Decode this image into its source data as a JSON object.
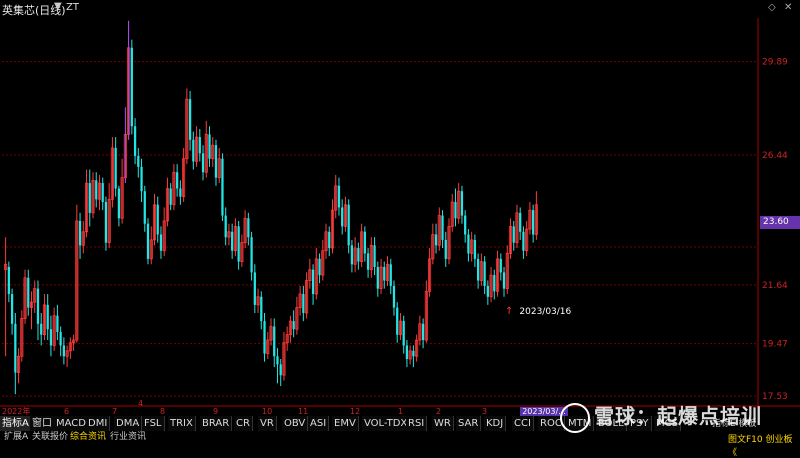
{
  "window": {
    "title": "英集芯(日线)",
    "dropdown_icon": "▼",
    "zt_label": "ZT"
  },
  "window_controls": [
    "◇",
    "✕"
  ],
  "axis": {
    "y_ticks": [
      "29.89",
      "26.44",
      "21.64",
      "19.47",
      "17.53"
    ],
    "current_price": "23.60"
  },
  "date_strip": {
    "months": [
      "2022年",
      "6",
      "7",
      "8",
      "9",
      "10",
      "11",
      "12",
      "1",
      "2",
      "3"
    ],
    "marker": "4",
    "cursor_date": "2023/03/..."
  },
  "annotation": {
    "arrow": "↑",
    "text": "2023/03/16"
  },
  "indicator_tabs": [
    "指标A",
    "窗口",
    "MACD",
    "DMI",
    "DMA",
    "FSL",
    "TRIX",
    "BRAR",
    "CR",
    "VR",
    "OBV",
    "ASI",
    "EMV",
    "VOL-TDX",
    "RSI",
    "WR",
    "SAR",
    "KDJ",
    "CCI",
    "ROC",
    "MTM",
    "BOLL",
    "PSY",
    "MCS"
  ],
  "sub_tabs": [
    "扩展A",
    "关联报价",
    "综合资讯",
    "行业资讯"
  ],
  "right_panel": {
    "mini_label": "指标E 模板",
    "f10_label": "图文F10 创业板《"
  },
  "watermark": {
    "text": "雪球：起爆点培训"
  },
  "colors": {
    "up": "#ff3b3b",
    "down": "#22e6e6",
    "bg": "#000000",
    "grid": "#7a0000",
    "price_tag": "#6633aa"
  },
  "chart_data": {
    "type": "candlestick",
    "ylim": [
      17.2,
      31.5
    ],
    "candles": [
      [
        22.2,
        22.4,
        23.4,
        19.0
      ],
      [
        22.3,
        21.3,
        22.5,
        21.0
      ],
      [
        21.3,
        20.2,
        21.5,
        19.8
      ],
      [
        20.2,
        18.4,
        20.6,
        17.6
      ],
      [
        18.4,
        19.0,
        19.3,
        18.0
      ],
      [
        19.0,
        20.4,
        20.7,
        18.8
      ],
      [
        20.4,
        21.9,
        22.2,
        20.2
      ],
      [
        21.9,
        20.8,
        22.2,
        20.5
      ],
      [
        20.8,
        21.0,
        21.4,
        20.0
      ],
      [
        21.0,
        21.5,
        21.8,
        20.6
      ],
      [
        21.5,
        20.2,
        21.8,
        19.6
      ],
      [
        20.2,
        19.8,
        20.6,
        19.4
      ],
      [
        19.8,
        20.9,
        21.3,
        19.6
      ],
      [
        20.9,
        20.0,
        21.3,
        19.6
      ],
      [
        20.0,
        19.4,
        20.5,
        19.0
      ],
      [
        19.4,
        20.5,
        20.8,
        19.2
      ],
      [
        20.5,
        19.9,
        20.9,
        19.6
      ],
      [
        19.9,
        19.4,
        20.1,
        19.0
      ],
      [
        19.4,
        19.0,
        19.7,
        18.7
      ],
      [
        19.0,
        19.2,
        19.4,
        18.6
      ],
      [
        19.2,
        19.5,
        19.7,
        18.9
      ],
      [
        19.5,
        19.6,
        19.8,
        19.2
      ],
      [
        19.6,
        24.0,
        24.6,
        19.5
      ],
      [
        24.0,
        23.1,
        24.3,
        22.6
      ],
      [
        23.1,
        23.6,
        24.0,
        22.8
      ],
      [
        23.6,
        25.4,
        25.9,
        23.4
      ],
      [
        25.4,
        24.3,
        25.9,
        23.8
      ],
      [
        24.3,
        25.5,
        25.8,
        24.1
      ],
      [
        25.5,
        24.8,
        25.8,
        24.5
      ],
      [
        24.8,
        25.4,
        25.7,
        24.4
      ],
      [
        25.4,
        24.7,
        25.6,
        24.4
      ],
      [
        24.7,
        23.2,
        24.9,
        22.9
      ],
      [
        23.2,
        24.8,
        25.4,
        23.0
      ],
      [
        24.8,
        26.7,
        27.1,
        24.5
      ],
      [
        26.7,
        25.2,
        27.1,
        24.9
      ],
      [
        25.2,
        24.1,
        25.3,
        23.8
      ],
      [
        24.1,
        25.6,
        26.3,
        23.9
      ],
      [
        25.6,
        27.2,
        28.2,
        25.4
      ],
      [
        27.2,
        30.4,
        31.4,
        27.0
      ],
      [
        30.4,
        27.5,
        30.7,
        27.2
      ],
      [
        27.5,
        26.4,
        27.8,
        26.1
      ],
      [
        26.4,
        26.0,
        26.7,
        25.6
      ],
      [
        26.0,
        25.1,
        26.3,
        24.7
      ],
      [
        25.1,
        23.9,
        25.3,
        23.6
      ],
      [
        23.9,
        22.6,
        24.1,
        22.4
      ],
      [
        22.6,
        23.3,
        23.8,
        22.4
      ],
      [
        23.3,
        24.6,
        25.0,
        23.1
      ],
      [
        24.6,
        23.5,
        24.9,
        23.2
      ],
      [
        23.5,
        22.9,
        23.8,
        22.6
      ],
      [
        22.9,
        24.0,
        24.5,
        22.7
      ],
      [
        24.0,
        25.2,
        25.6,
        23.8
      ],
      [
        25.2,
        24.6,
        25.4,
        24.4
      ],
      [
        24.6,
        25.8,
        26.1,
        24.4
      ],
      [
        25.8,
        25.2,
        26.1,
        24.9
      ],
      [
        25.2,
        24.9,
        25.5,
        24.6
      ],
      [
        24.9,
        26.3,
        26.7,
        24.7
      ],
      [
        26.3,
        28.5,
        28.9,
        26.1
      ],
      [
        28.5,
        27.0,
        28.8,
        26.6
      ],
      [
        27.0,
        26.2,
        27.3,
        25.9
      ],
      [
        26.2,
        27.1,
        27.5,
        26.0
      ],
      [
        27.1,
        26.5,
        27.4,
        26.2
      ],
      [
        26.5,
        25.8,
        26.8,
        25.5
      ],
      [
        25.8,
        27.2,
        27.7,
        25.6
      ],
      [
        27.2,
        26.3,
        27.5,
        26.0
      ],
      [
        26.3,
        26.8,
        27.1,
        26.0
      ],
      [
        26.8,
        25.6,
        27.0,
        25.3
      ],
      [
        25.6,
        26.3,
        26.7,
        25.4
      ],
      [
        26.3,
        24.2,
        26.5,
        24.0
      ],
      [
        24.2,
        23.4,
        24.5,
        23.1
      ],
      [
        23.4,
        23.6,
        23.9,
        23.1
      ],
      [
        23.6,
        22.9,
        23.9,
        22.6
      ],
      [
        22.9,
        23.8,
        24.1,
        22.7
      ],
      [
        23.8,
        22.5,
        24.0,
        22.2
      ],
      [
        22.5,
        23.2,
        23.5,
        22.3
      ],
      [
        23.2,
        24.1,
        24.4,
        23.0
      ],
      [
        24.1,
        23.4,
        24.3,
        23.1
      ],
      [
        23.4,
        22.1,
        23.6,
        21.8
      ],
      [
        22.1,
        20.9,
        22.4,
        20.6
      ],
      [
        20.9,
        21.2,
        21.5,
        20.6
      ],
      [
        21.2,
        20.3,
        21.4,
        20.0
      ],
      [
        20.3,
        19.1,
        20.6,
        18.8
      ],
      [
        19.1,
        19.6,
        19.9,
        18.9
      ],
      [
        19.6,
        20.1,
        20.4,
        19.4
      ],
      [
        20.1,
        19.0,
        20.4,
        18.6
      ],
      [
        19.0,
        18.7,
        19.3,
        18.0
      ],
      [
        18.7,
        18.3,
        18.9,
        17.9
      ],
      [
        18.3,
        19.5,
        19.9,
        18.1
      ],
      [
        19.5,
        19.8,
        20.1,
        19.2
      ],
      [
        19.8,
        20.3,
        20.5,
        19.5
      ],
      [
        20.3,
        20.0,
        20.7,
        19.7
      ],
      [
        20.0,
        20.8,
        21.2,
        19.8
      ],
      [
        20.8,
        21.3,
        21.6,
        20.5
      ],
      [
        21.3,
        20.6,
        21.6,
        20.3
      ],
      [
        20.6,
        21.8,
        22.1,
        20.4
      ],
      [
        21.8,
        22.2,
        22.6,
        21.5
      ],
      [
        22.2,
        21.3,
        22.4,
        20.9
      ],
      [
        21.3,
        22.6,
        23.0,
        21.1
      ],
      [
        22.6,
        22.0,
        22.8,
        21.7
      ],
      [
        22.0,
        22.9,
        23.3,
        21.8
      ],
      [
        22.9,
        23.6,
        23.9,
        22.6
      ],
      [
        23.6,
        23.0,
        23.8,
        22.7
      ],
      [
        23.0,
        24.4,
        24.8,
        22.8
      ],
      [
        24.4,
        25.3,
        25.7,
        24.1
      ],
      [
        25.3,
        24.5,
        25.6,
        24.2
      ],
      [
        24.5,
        23.8,
        24.8,
        23.5
      ],
      [
        23.8,
        24.6,
        24.9,
        23.6
      ],
      [
        24.6,
        23.1,
        24.8,
        22.8
      ],
      [
        23.1,
        22.4,
        23.3,
        22.1
      ],
      [
        22.4,
        23.0,
        23.4,
        22.1
      ],
      [
        23.0,
        22.5,
        23.2,
        22.2
      ],
      [
        22.5,
        23.6,
        23.9,
        22.3
      ],
      [
        23.6,
        22.8,
        23.8,
        22.5
      ],
      [
        22.8,
        22.2,
        23.0,
        21.9
      ],
      [
        22.2,
        23.1,
        23.4,
        21.9
      ],
      [
        23.1,
        22.3,
        23.4,
        22.0
      ],
      [
        22.3,
        21.5,
        22.5,
        21.2
      ],
      [
        21.5,
        22.3,
        22.6,
        21.3
      ],
      [
        22.3,
        21.8,
        22.5,
        21.5
      ],
      [
        21.8,
        22.4,
        22.7,
        21.6
      ],
      [
        22.4,
        21.6,
        22.6,
        21.3
      ],
      [
        21.6,
        20.8,
        21.8,
        20.5
      ],
      [
        20.8,
        19.8,
        21.0,
        19.5
      ],
      [
        19.8,
        20.3,
        20.6,
        19.6
      ],
      [
        20.3,
        19.4,
        20.5,
        19.1
      ],
      [
        19.4,
        18.9,
        19.6,
        18.6
      ],
      [
        18.9,
        19.2,
        19.4,
        18.7
      ],
      [
        19.2,
        19.0,
        19.4,
        18.6
      ],
      [
        19.0,
        19.6,
        19.8,
        18.8
      ],
      [
        19.6,
        20.2,
        20.5,
        19.4
      ],
      [
        20.2,
        19.6,
        20.4,
        19.3
      ],
      [
        19.6,
        21.4,
        21.8,
        19.5
      ],
      [
        21.4,
        22.6,
        23.0,
        21.2
      ],
      [
        22.6,
        23.5,
        23.9,
        22.4
      ],
      [
        23.5,
        23.1,
        23.9,
        22.8
      ],
      [
        23.1,
        24.2,
        24.5,
        22.9
      ],
      [
        24.2,
        23.3,
        24.4,
        23.0
      ],
      [
        23.3,
        22.6,
        23.6,
        22.3
      ],
      [
        22.6,
        23.8,
        24.1,
        22.4
      ],
      [
        23.8,
        24.7,
        25.0,
        23.6
      ],
      [
        24.7,
        24.1,
        25.2,
        23.8
      ],
      [
        24.1,
        25.1,
        25.4,
        23.9
      ],
      [
        25.1,
        24.2,
        25.3,
        23.9
      ],
      [
        24.2,
        23.5,
        24.4,
        23.2
      ],
      [
        23.5,
        22.8,
        23.7,
        22.5
      ],
      [
        22.8,
        23.3,
        23.6,
        22.5
      ],
      [
        23.3,
        22.6,
        23.5,
        22.3
      ],
      [
        22.6,
        21.8,
        22.8,
        21.5
      ],
      [
        21.8,
        22.5,
        22.8,
        21.6
      ],
      [
        22.5,
        21.6,
        22.7,
        21.3
      ],
      [
        21.6,
        21.2,
        21.8,
        20.9
      ],
      [
        21.2,
        22.0,
        22.3,
        21.0
      ],
      [
        22.0,
        21.4,
        22.2,
        21.1
      ],
      [
        21.4,
        22.6,
        22.9,
        21.2
      ],
      [
        22.6,
        22.1,
        22.8,
        21.8
      ],
      [
        22.1,
        21.5,
        22.3,
        21.2
      ],
      [
        21.5,
        22.8,
        23.1,
        21.3
      ],
      [
        22.8,
        23.8,
        24.1,
        22.6
      ],
      [
        23.8,
        23.2,
        24.0,
        22.9
      ],
      [
        23.2,
        24.3,
        24.6,
        23.0
      ],
      [
        24.3,
        23.6,
        24.5,
        23.3
      ],
      [
        23.6,
        22.9,
        23.8,
        22.6
      ],
      [
        22.9,
        23.7,
        24.0,
        22.7
      ],
      [
        23.7,
        24.4,
        24.7,
        23.5
      ],
      [
        24.4,
        23.5,
        24.6,
        23.2
      ],
      [
        23.5,
        24.6,
        25.1,
        23.3
      ]
    ]
  }
}
